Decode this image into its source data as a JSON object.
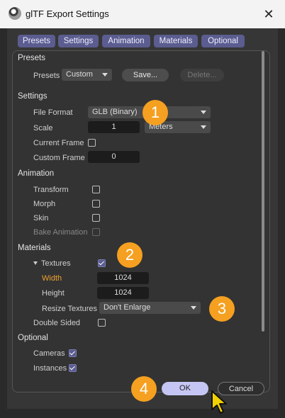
{
  "window": {
    "title": "glTF Export Settings"
  },
  "tabs": [
    "Presets",
    "Settings",
    "Animation",
    "Materials",
    "Optional"
  ],
  "presets": {
    "section": "Presets",
    "label": "Presets",
    "value": "Custom",
    "save_label": "Save...",
    "delete_label": "Delete..."
  },
  "settings": {
    "section": "Settings",
    "file_format_label": "File Format",
    "file_format_value": "GLB (Binary)",
    "scale_label": "Scale",
    "scale_value": "1",
    "scale_unit": "Meters",
    "current_frame_label": "Current Frame",
    "current_frame_checked": false,
    "custom_frame_label": "Custom Frame",
    "custom_frame_value": "0"
  },
  "animation": {
    "section": "Animation",
    "transform_label": "Transform",
    "morph_label": "Morph",
    "skin_label": "Skin",
    "bake_label": "Bake Animation"
  },
  "materials": {
    "section": "Materials",
    "textures_label": "Textures",
    "textures_checked": true,
    "width_label": "Width",
    "width_value": "1024",
    "height_label": "Height",
    "height_value": "1024",
    "resize_label": "Resize Textures",
    "resize_value": "Don't Enlarge",
    "double_sided_label": "Double Sided"
  },
  "optional": {
    "section": "Optional",
    "cameras_label": "Cameras",
    "cameras_checked": true,
    "instances_label": "Instances",
    "instances_checked": true
  },
  "footer": {
    "ok_label": "OK",
    "cancel_label": "Cancel"
  },
  "badges": [
    "1",
    "2",
    "3",
    "4"
  ],
  "colors": {
    "accent": "#5b5c8f",
    "badge": "#f5a020",
    "ok_button": "#c5c6f3",
    "highlight_label": "#f0a030"
  },
  "icons": [
    "app-icon",
    "close-icon",
    "checkbox-icon",
    "chevron-down-icon",
    "cursor-icon"
  ]
}
